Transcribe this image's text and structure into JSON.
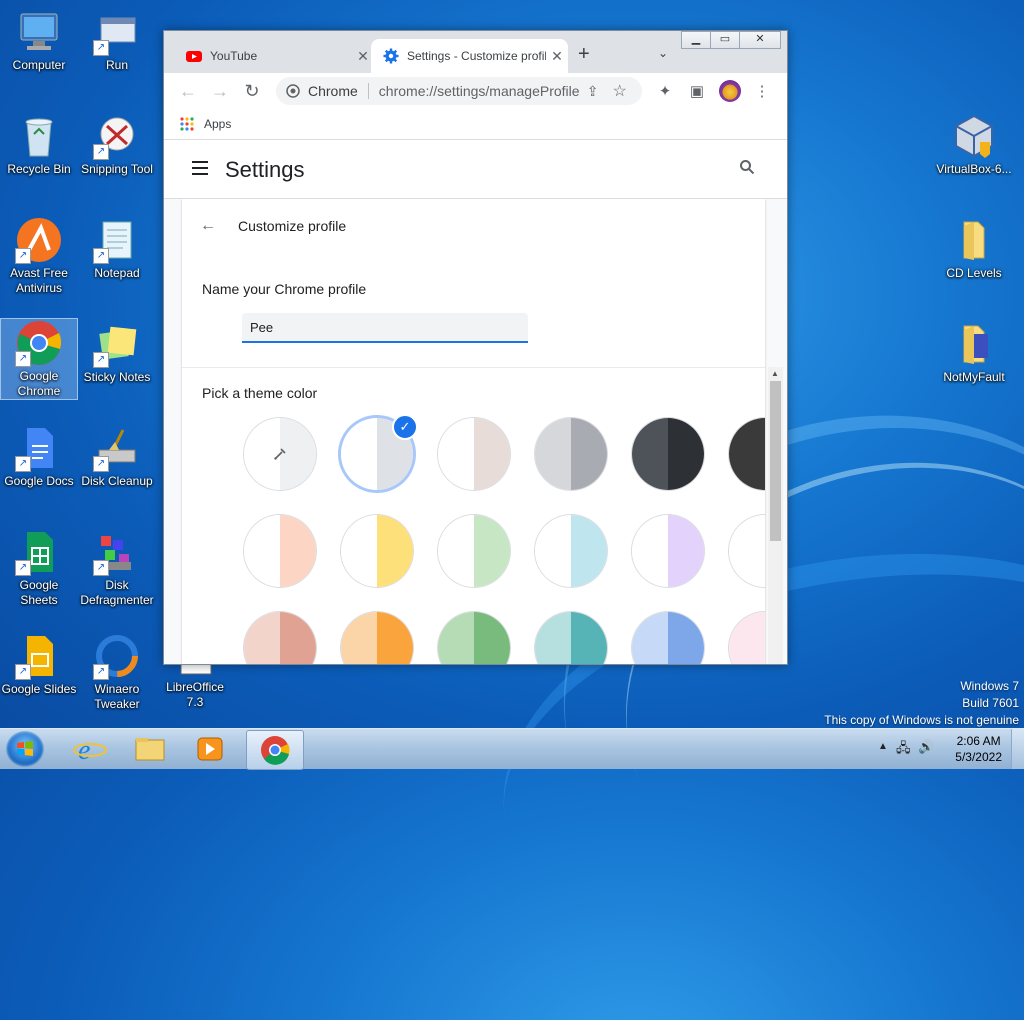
{
  "desktop": {
    "icons": [
      {
        "label": "Computer"
      },
      {
        "label": "Run"
      },
      {
        "label": "Recycle Bin"
      },
      {
        "label": "Snipping Tool"
      },
      {
        "label": "Avast Free Antivirus"
      },
      {
        "label": "Notepad"
      },
      {
        "label": "Google Chrome"
      },
      {
        "label": "Sticky Notes"
      },
      {
        "label": "Google Docs"
      },
      {
        "label": "Disk Cleanup"
      },
      {
        "label": "Google Sheets"
      },
      {
        "label": "Disk Defragmenter"
      },
      {
        "label": "Google Slides"
      },
      {
        "label": "Winaero Tweaker"
      },
      {
        "label": "LibreOffice 7.3"
      },
      {
        "label": "VirtualBox-6..."
      },
      {
        "label": "CD Levels"
      },
      {
        "label": "NotMyFault"
      }
    ]
  },
  "watermark": {
    "line1": "Windows 7",
    "line2": "Build 7601",
    "line3": "This copy of Windows is not genuine"
  },
  "taskbar": {
    "time": "2:06 AM",
    "date": "5/3/2022"
  },
  "browser": {
    "tabs": [
      {
        "title": "YouTube"
      },
      {
        "title": "Settings - Customize profile"
      }
    ],
    "new_tab": "+",
    "omnibox": {
      "site": "Chrome",
      "url": "chrome://settings/manageProfile"
    },
    "bookmarks": {
      "apps": "Apps"
    }
  },
  "settings": {
    "title": "Settings",
    "page_title": "Customize profile",
    "name_label": "Name your Chrome profile",
    "name_value": "Pee",
    "theme_label": "Pick a theme color",
    "selected_index": 1,
    "colors": [
      {
        "left": "#ffffff",
        "right": "#eef0f2"
      },
      {
        "left": "#ffffff",
        "right": "#dee1e6"
      },
      {
        "left": "#ffffff",
        "right": "#e8dcd8"
      },
      {
        "left": "#d5d7db",
        "right": "#a8abb2"
      },
      {
        "left": "#4d5358",
        "right": "#2d3135"
      },
      {
        "left": "#3a3a3a",
        "right": "#202124"
      },
      {
        "left": "#ffffff",
        "right": "#fcd5c5"
      },
      {
        "left": "#ffffff",
        "right": "#fde07a"
      },
      {
        "left": "#ffffff",
        "right": "#c7e6c3"
      },
      {
        "left": "#ffffff",
        "right": "#bfe6ef"
      },
      {
        "left": "#ffffff",
        "right": "#e3d2fb"
      },
      {
        "left": "#ffffff",
        "right": "#fde3e7"
      },
      {
        "left": "#f2d4cb",
        "right": "#e0a393"
      },
      {
        "left": "#fbd5a8",
        "right": "#f9a43c"
      },
      {
        "left": "#b5dcb5",
        "right": "#79bb7c"
      },
      {
        "left": "#b5e0df",
        "right": "#56b4b6"
      },
      {
        "left": "#c6d9f6",
        "right": "#7ea7e9"
      },
      {
        "left": "#fde7ee",
        "right": "#f6b7c8"
      }
    ]
  }
}
